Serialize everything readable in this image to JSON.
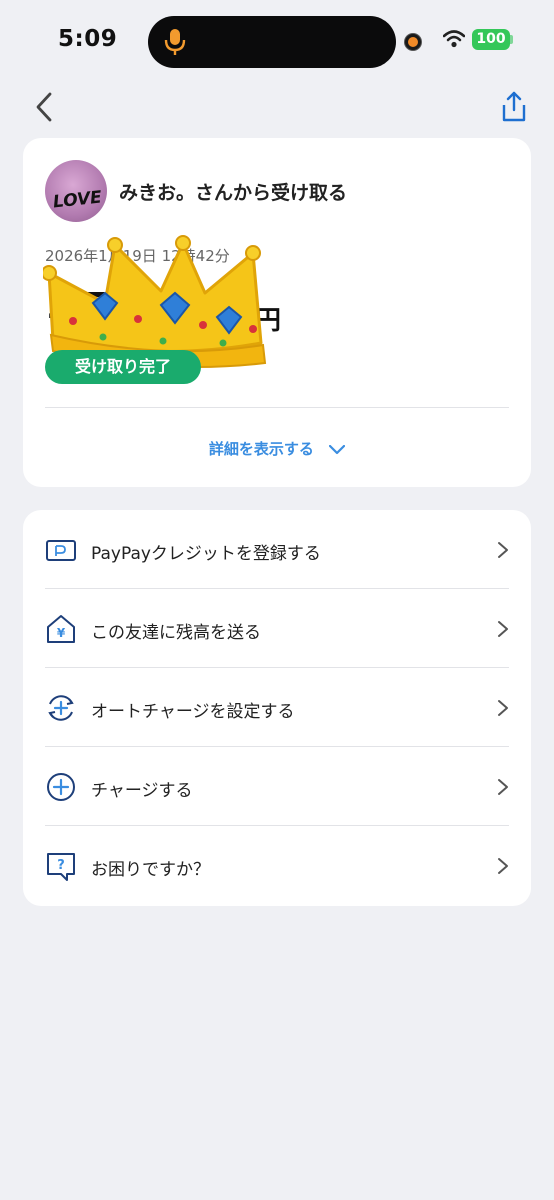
{
  "status_bar": {
    "time": "5:09",
    "battery": "100"
  },
  "nav": {
    "back_icon": "chevron-left-icon",
    "share_icon": "share-icon"
  },
  "transaction": {
    "avatar_text": "LOVE",
    "sender_text": "みきお。さんから受け取る",
    "datetime": "2026年1月19日 12時42分",
    "amount": "1,500",
    "currency": "円",
    "status": "受け取り完了",
    "details_link": "詳細を表示する"
  },
  "menu": {
    "items": [
      {
        "label": "PayPayクレジットを登録する",
        "icon": "credit-card-icon"
      },
      {
        "label": "この友達に残高を送る",
        "icon": "send-money-icon"
      },
      {
        "label": "オートチャージを設定する",
        "icon": "auto-charge-icon"
      },
      {
        "label": "チャージする",
        "icon": "plus-circle-icon"
      },
      {
        "label": "お困りですか？",
        "icon": "help-icon"
      }
    ]
  },
  "colors": {
    "background": "#eff0f4",
    "accent_blue": "#3a8de0",
    "badge_green": "#1aab6d",
    "icon_navy": "#1e3f7a"
  }
}
